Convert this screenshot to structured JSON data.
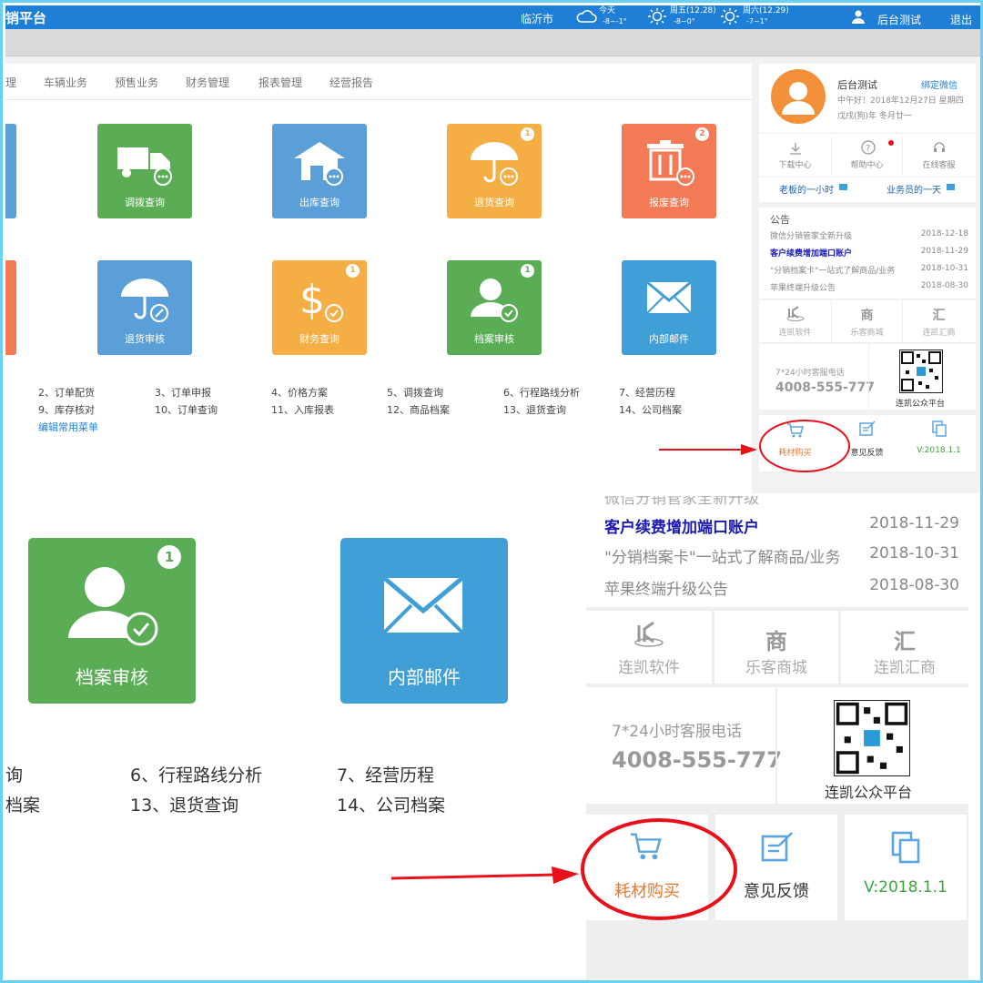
{
  "top": {
    "header": {
      "brand": "销平台",
      "city": "临沂市",
      "weather": [
        {
          "day": "今天",
          "temp": "-8~-1°",
          "icon": "cloud-icon"
        },
        {
          "day": "周五(12.28)",
          "temp": "-8~0°",
          "icon": "sun-icon"
        },
        {
          "day": "周六(12.29)",
          "temp": "-7~1°",
          "icon": "sun-icon"
        }
      ],
      "user": "后台测试",
      "logout": "退出"
    },
    "tabs": [
      "理",
      "车辆业务",
      "预售业务",
      "财务管理",
      "报表管理",
      "经营报告"
    ],
    "tiles": [
      {
        "label": "调拨查询",
        "badge": "",
        "color": "#5aad55",
        "icon": "truck-icon"
      },
      {
        "label": "出库查询",
        "badge": "",
        "color": "#5b9fd8",
        "icon": "warehouse-icon"
      },
      {
        "label": "退货查询",
        "badge": "1",
        "color": "#f4ae43",
        "icon": "umbrella-icon"
      },
      {
        "label": "报废查询",
        "badge": "2",
        "color": "#f27a55",
        "icon": "trash-icon"
      },
      {
        "label": "退货审核",
        "badge": "",
        "color": "#5b9fd8",
        "icon": "umbrella-edit-icon"
      },
      {
        "label": "财务查询",
        "badge": "1",
        "color": "#f4ae43",
        "icon": "dollar-icon"
      },
      {
        "label": "档案审核",
        "badge": "1",
        "color": "#5aad55",
        "icon": "user-check-icon"
      },
      {
        "label": "内部邮件",
        "badge": "",
        "color": "#3f9fd6",
        "icon": "mail-icon"
      }
    ],
    "menu_row1": [
      "2、订单配货",
      "3、订单申报",
      "4、价格方案",
      "5、调拨查询",
      "6、行程路线分析",
      "7、经营历程"
    ],
    "menu_row2": [
      "9、库存核对",
      "10、订单查询",
      "11、入库报表",
      "12、商品档案",
      "13、退货查询",
      "14、公司档案"
    ],
    "edit_menu": "编辑常用菜单",
    "profile": {
      "name": "后台测试",
      "bind": "绑定微信",
      "greeting": "中午好！2018年12月27日 星期四",
      "lunar": "戊戌(狗)年 冬月廿一"
    },
    "quick": [
      "下载中心",
      "帮助中心",
      "在线客服"
    ],
    "videos": [
      "老板的一小时",
      "业务员的一天"
    ],
    "notice": {
      "title": "公告",
      "items": [
        {
          "text": "微信分销管家全新升级",
          "date": "2018-12-18"
        },
        {
          "text": "客户续费增加端口账户",
          "date": "2018-11-29"
        },
        {
          "text": "\"分销档案卡\"一站式了解商品/业务",
          "date": "2018-10-31"
        },
        {
          "text": "苹果终端升级公告",
          "date": "2018-08-30"
        }
      ]
    },
    "partners": [
      {
        "mark": "",
        "label": "连凯软件"
      },
      {
        "mark": "商",
        "label": "乐客商城"
      },
      {
        "mark": "汇",
        "label": "连凯汇商"
      }
    ],
    "service": {
      "label": "7*24小时客服电话",
      "phone": "4008-555-777",
      "qr_label": "连凯公众平台"
    },
    "bottom": {
      "buy": "耗材购买",
      "feedback": "意见反馈",
      "version": "V:2018.1.1"
    }
  },
  "bottom": {
    "tiles": [
      {
        "label": "档案审核",
        "badge": "1",
        "color": "#5aad55"
      },
      {
        "label": "内部邮件",
        "color": "#3f9fd6"
      }
    ],
    "menu_row1": [
      "询",
      "6、行程路线分析",
      "7、经营历程"
    ],
    "menu_row2": [
      "档案",
      "13、退货查询",
      "14、公司档案"
    ],
    "notice_partial": "微信分销管家全新升级",
    "notice": [
      {
        "text": "客户续费增加端口账户",
        "date": "2018-11-29"
      },
      {
        "text": "\"分销档案卡\"一站式了解商品/业务",
        "date": "2018-10-31"
      },
      {
        "text": "苹果终端升级公告",
        "date": "2018-08-30"
      }
    ],
    "partners": [
      {
        "mark": "",
        "label": "连凯软件"
      },
      {
        "mark": "商",
        "label": "乐客商城"
      },
      {
        "mark": "汇",
        "label": "连凯汇商"
      }
    ],
    "service": {
      "label": "7*24小时客服电话",
      "phone": "4008-555-777",
      "qr_label": "连凯公众平台"
    },
    "buy": "耗材购买",
    "feedback": "意见反馈",
    "version": "V:2018.1.1"
  },
  "colors": {
    "accent": "#1f7fd6",
    "highlight_circle": "#e8101a",
    "arrow": "#e8101a",
    "version_green": "#3aa53a",
    "buy_orange": "#e8772a"
  }
}
